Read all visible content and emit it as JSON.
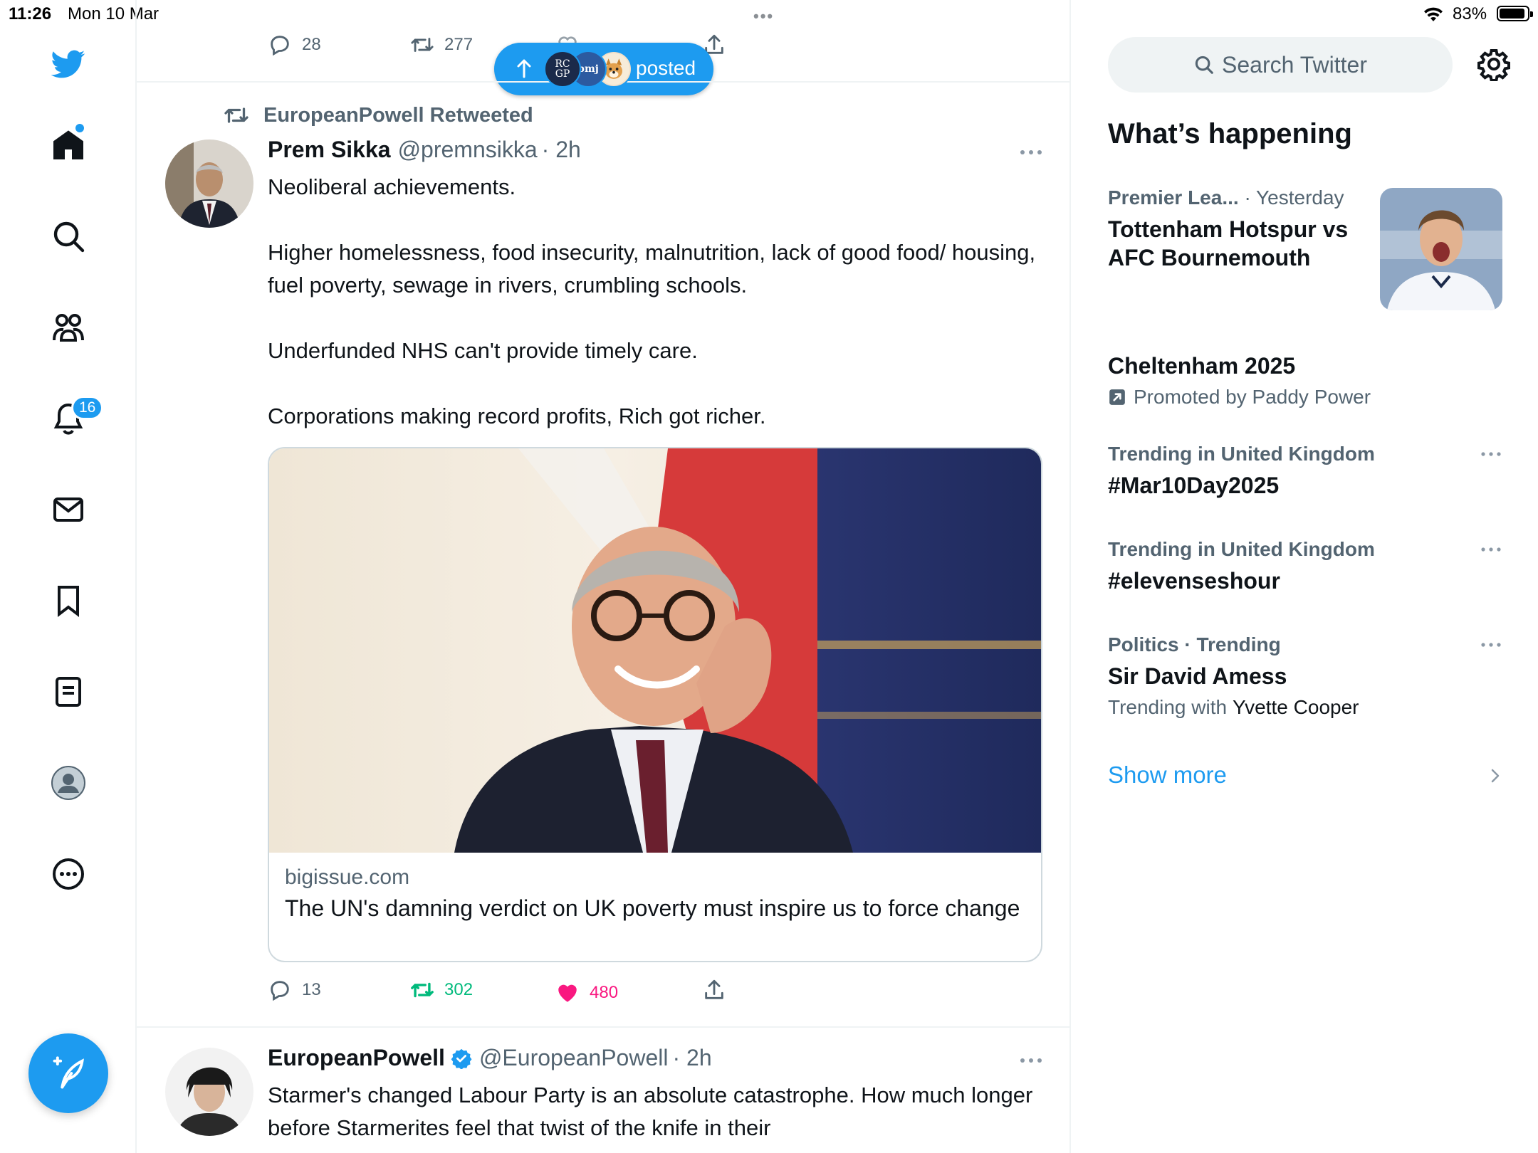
{
  "status_bar": {
    "time": "11:26",
    "date": "Mon 10 Mar",
    "battery": "83%"
  },
  "nav": {
    "notifications_badge": "16",
    "items": [
      "twitter-logo",
      "home-icon",
      "search-icon",
      "communities-icon",
      "notifications-icon",
      "messages-icon",
      "bookmarks-icon",
      "lists-icon",
      "profile-icon",
      "more-icon"
    ],
    "compose_icon": "compose-icon"
  },
  "prev_tweet_actions": {
    "replies": "28",
    "retweets": "277"
  },
  "new_posts_pill": {
    "label": "posted",
    "avatars": [
      "RC GP",
      "bmj",
      "dog-avatar"
    ]
  },
  "tweet1": {
    "retweeted_by": "EuropeanPowell Retweeted",
    "name": "Prem Sikka",
    "handle": "@premnsikka",
    "time": "· 2h",
    "text": [
      "Neoliberal achievements.",
      "Higher homelessness, food insecurity, malnutrition, lack of good food/ housing, fuel poverty, sewage in rivers, crumbling schools.",
      "Underfunded NHS can't provide timely care.",
      "Corporations making record profits, Rich got richer."
    ],
    "card": {
      "domain": "bigissue.com",
      "title": "The UN's damning verdict on UK poverty must inspire us to force change"
    },
    "actions": {
      "replies": "13",
      "retweets": "302",
      "likes": "480"
    }
  },
  "tweet2": {
    "name": "EuropeanPowell",
    "handle": "@EuropeanPowell",
    "time": "· 2h",
    "text": "Starmer's changed Labour Party is an absolute catastrophe. How much longer before Starmerites feel that twist of the knife in their"
  },
  "sidebar": {
    "search_placeholder": "Search Twitter",
    "section_title": "What’s happening",
    "trends": [
      {
        "category": "Premier Lea...",
        "time": "· Yesterday",
        "headline": "Tottenham Hotspur vs AFC Bournemouth"
      },
      {
        "headline": "Cheltenham 2025",
        "sub": "Promoted by Paddy Power"
      },
      {
        "category": "Trending in United Kingdom",
        "headline": "#Mar10Day2025"
      },
      {
        "category": "Trending in United Kingdom",
        "headline": "#elevenseshour"
      },
      {
        "category": "Politics · Trending",
        "headline": "Sir David Amess",
        "sub_prefix": "Trending with",
        "sub_who": "Yvette Cooper"
      }
    ],
    "show_more": "Show more"
  },
  "colors": {
    "accent": "#1d9bf0",
    "retweet_green": "#00ba7c",
    "like_pink": "#f91880",
    "secondary_text": "#536471"
  }
}
